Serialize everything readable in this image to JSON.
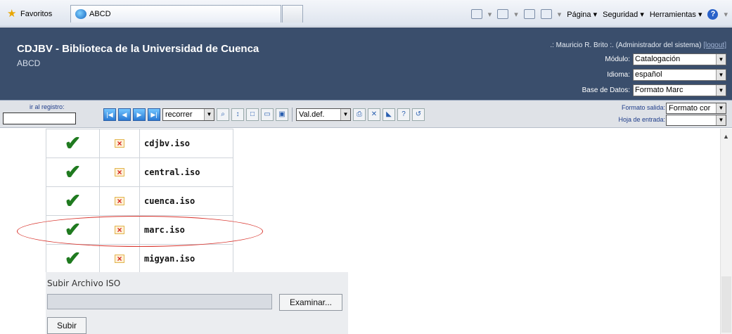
{
  "browser": {
    "favorites_label": "Favoritos",
    "tab_title": "ABCD",
    "commands": {
      "page": "Página",
      "safety": "Seguridad",
      "tools": "Herramientas"
    }
  },
  "header": {
    "title": "CDJBV - Biblioteca de la Universidad de Cuenca",
    "subtitle": "ABCD",
    "user_info": ".: Mauricio R. Brito :. (Administrador del sistema)",
    "logout": "[logout]",
    "module_label": "Módulo:",
    "module_value": "Catalogación",
    "language_label": "Idioma:",
    "language_value": "español",
    "database_label": "Base de Datos:",
    "database_value": "Formato Marc"
  },
  "toolbar": {
    "goto_label": "ir al registro:",
    "browse_select": "recorrer",
    "defaults_select": "Val.def.",
    "output_format_label": "Formato salida:",
    "output_format_value": "Formato cor",
    "entry_sheet_label": "Hoja de entrada:",
    "entry_sheet_value": ""
  },
  "files": {
    "rows": [
      {
        "name": "cdjbv.iso"
      },
      {
        "name": "central.iso"
      },
      {
        "name": "cuenca.iso"
      },
      {
        "name": "marc.iso"
      },
      {
        "name": "migyan.iso"
      }
    ],
    "highlighted": "marc.iso"
  },
  "upload": {
    "title": "Subir Archivo ISO",
    "browse_label": "Examinar...",
    "submit_label": "Subir"
  }
}
